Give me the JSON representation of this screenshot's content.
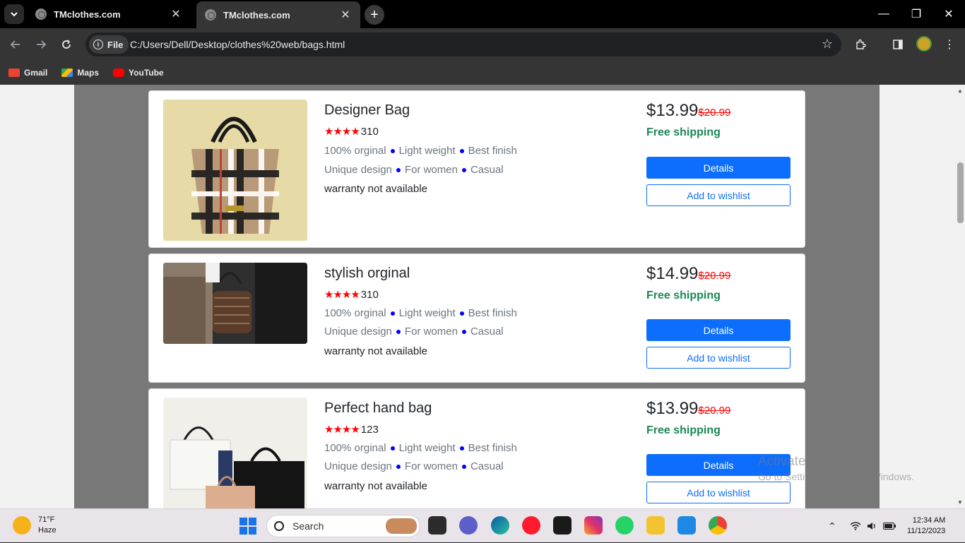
{
  "browser": {
    "tabs": [
      {
        "title": "TMclothes.com",
        "close": "✕"
      },
      {
        "title": "TMclothes.com",
        "close": "✕"
      }
    ],
    "new_tab": "+",
    "window": {
      "minimize": "—",
      "maximize": "❐",
      "close": "✕"
    },
    "url_chip": "File",
    "url": "C:/Users/Dell/Desktop/clothes%20web/bags.html",
    "bookmarks": [
      {
        "label": "Gmail",
        "color": "#ea4335"
      },
      {
        "label": "Maps",
        "color": "#34a853"
      },
      {
        "label": "YouTube",
        "color": "#ff0000"
      }
    ]
  },
  "products": [
    {
      "title": "Designer Bag",
      "stars": "★★★★",
      "reviews": "310",
      "features_row1": [
        "100% orginal",
        "Light weight",
        "Best finish"
      ],
      "features_row2": [
        "Unique design",
        "For women",
        "Casual"
      ],
      "warranty": "warranty not available",
      "price": "$13.99",
      "old_price": "$20.99",
      "shipping": "Free shipping",
      "details_label": "Details",
      "wishlist_label": "Add to wishlist"
    },
    {
      "title": "stylish orginal",
      "stars": "★★★★",
      "reviews": "310",
      "features_row1": [
        "100% orginal",
        "Light weight",
        "Best finish"
      ],
      "features_row2": [
        "Unique design",
        "For women",
        "Casual"
      ],
      "warranty": "warranty not available",
      "price": "$14.99",
      "old_price": "$20.99",
      "shipping": "Free shipping",
      "details_label": "Details",
      "wishlist_label": "Add to wishlist"
    },
    {
      "title": "Perfect hand bag",
      "stars": "★★★★",
      "reviews": "123",
      "features_row1": [
        "100% orginal",
        "Light weight",
        "Best finish"
      ],
      "features_row2": [
        "Unique design",
        "For women",
        "Casual"
      ],
      "warranty": "warranty not available",
      "price": "$13.99",
      "old_price": "$20.99",
      "shipping": "Free shipping",
      "details_label": "Details",
      "wishlist_label": "Add to wishlist"
    }
  ],
  "watermark": {
    "line1": "Activate Windows",
    "line2": "Go to Settings to activate Windows."
  },
  "taskbar": {
    "weather_temp": "71°F",
    "weather_desc": "Haze",
    "search_placeholder": "Search",
    "time": "12:34 AM",
    "date": "11/12/2023"
  },
  "colors": {
    "accent": "#0d6efd",
    "shipping": "#198754",
    "star": "#ff0000",
    "old_price": "#ff0000"
  }
}
